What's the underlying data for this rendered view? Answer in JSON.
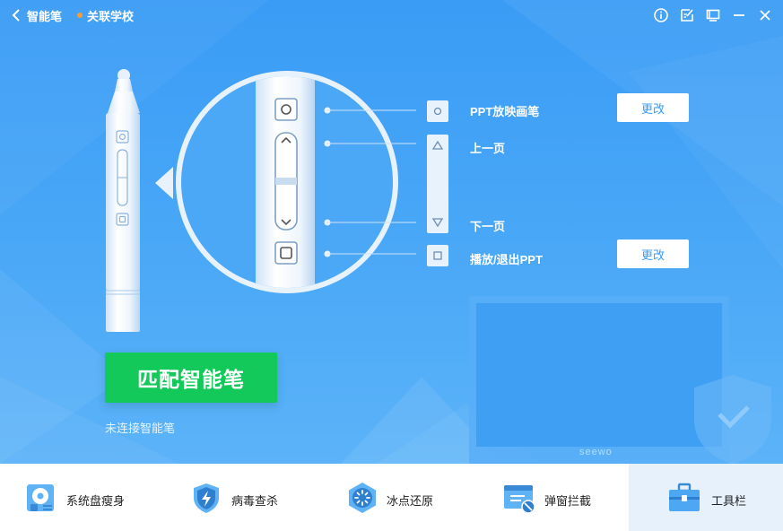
{
  "titlebar": {
    "back_label": "智能笔",
    "school_label": "关联学校",
    "buttons": [
      "info-icon",
      "feedback-icon",
      "screen-icon",
      "minimize-icon",
      "close-icon"
    ]
  },
  "pen_functions": {
    "ppt_pen": {
      "label": "PPT放映画笔",
      "button": "更改"
    },
    "prev_page": {
      "label": "上一页"
    },
    "next_page": {
      "label": "下一页"
    },
    "play_exit": {
      "label": "播放/退出PPT",
      "button": "更改"
    }
  },
  "match_button": "匹配智能笔",
  "status_text": "未连接智能笔",
  "brand_watermark": "seewo",
  "colors": {
    "primary": "#3a9cf5",
    "match_green": "#12c95a",
    "active_tab_bg": "#e6f1fc"
  },
  "bottom_tools": [
    {
      "label": "系统盘瘦身",
      "icon": "disk-cleanup-icon"
    },
    {
      "label": "病毒查杀",
      "icon": "virus-shield-icon"
    },
    {
      "label": "冰点还原",
      "icon": "freeze-restore-icon"
    },
    {
      "label": "弹窗拦截",
      "icon": "popup-block-icon"
    },
    {
      "label": "工具栏",
      "icon": "toolbox-icon",
      "active": true
    }
  ]
}
